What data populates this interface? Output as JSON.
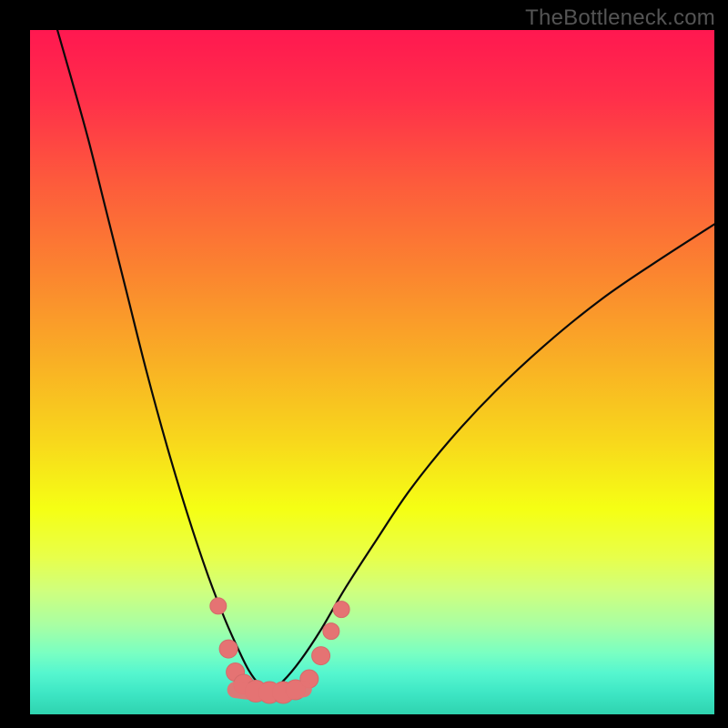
{
  "watermark": "TheBottleneck.com",
  "chart_data": {
    "type": "line",
    "title": "",
    "xlabel": "",
    "ylabel": "",
    "xlim": [
      0,
      1
    ],
    "ylim": [
      0,
      1
    ],
    "note": "V-shaped bottleneck curve over a red→yellow→green vertical gradient. Apex sits near x≈0.35, y≈0.03. Salmon marker points cluster along the curve near the trough.",
    "gradient_stops": [
      {
        "offset": 0.0,
        "color": "#ff1850"
      },
      {
        "offset": 0.1,
        "color": "#ff2f4a"
      },
      {
        "offset": 0.22,
        "color": "#fd5a3c"
      },
      {
        "offset": 0.35,
        "color": "#fb8330"
      },
      {
        "offset": 0.48,
        "color": "#f9ae25"
      },
      {
        "offset": 0.6,
        "color": "#f8d71c"
      },
      {
        "offset": 0.7,
        "color": "#f5ff14"
      },
      {
        "offset": 0.77,
        "color": "#e8ff4a"
      },
      {
        "offset": 0.82,
        "color": "#cfff7e"
      },
      {
        "offset": 0.87,
        "color": "#a8ffa4"
      },
      {
        "offset": 0.91,
        "color": "#7affc2"
      },
      {
        "offset": 0.94,
        "color": "#55f6cf"
      },
      {
        "offset": 0.97,
        "color": "#3de6c4"
      },
      {
        "offset": 1.0,
        "color": "#2fd3af"
      }
    ],
    "series": [
      {
        "name": "left-curve",
        "x": [
          0.04,
          0.06,
          0.085,
          0.11,
          0.14,
          0.17,
          0.2,
          0.23,
          0.26,
          0.285,
          0.305,
          0.32,
          0.335,
          0.35
        ],
        "y": [
          1.0,
          0.93,
          0.84,
          0.74,
          0.62,
          0.5,
          0.39,
          0.29,
          0.2,
          0.135,
          0.09,
          0.06,
          0.04,
          0.03
        ]
      },
      {
        "name": "right-curve",
        "x": [
          0.35,
          0.37,
          0.395,
          0.425,
          0.46,
          0.505,
          0.555,
          0.615,
          0.68,
          0.755,
          0.835,
          0.915,
          1.0
        ],
        "y": [
          0.03,
          0.045,
          0.075,
          0.12,
          0.18,
          0.25,
          0.325,
          0.4,
          0.47,
          0.54,
          0.605,
          0.66,
          0.715
        ]
      },
      {
        "name": "trough-flat",
        "x": [
          0.3,
          0.315,
          0.335,
          0.358,
          0.38,
          0.4
        ],
        "y": [
          0.032,
          0.03,
          0.029,
          0.029,
          0.03,
          0.033
        ]
      }
    ],
    "markers": [
      {
        "x": 0.275,
        "y": 0.155,
        "r": 9
      },
      {
        "x": 0.29,
        "y": 0.092,
        "r": 10
      },
      {
        "x": 0.3,
        "y": 0.058,
        "r": 10
      },
      {
        "x": 0.312,
        "y": 0.04,
        "r": 11
      },
      {
        "x": 0.33,
        "y": 0.03,
        "r": 12
      },
      {
        "x": 0.35,
        "y": 0.028,
        "r": 12
      },
      {
        "x": 0.37,
        "y": 0.028,
        "r": 12
      },
      {
        "x": 0.388,
        "y": 0.032,
        "r": 11
      },
      {
        "x": 0.408,
        "y": 0.048,
        "r": 10
      },
      {
        "x": 0.425,
        "y": 0.082,
        "r": 10
      },
      {
        "x": 0.44,
        "y": 0.118,
        "r": 9
      },
      {
        "x": 0.455,
        "y": 0.15,
        "r": 9
      }
    ],
    "marker_fill": "#e57373",
    "marker_stroke": "#d46a6a",
    "curve_stroke": "#0a0a0a",
    "curve_width": 2.2
  }
}
